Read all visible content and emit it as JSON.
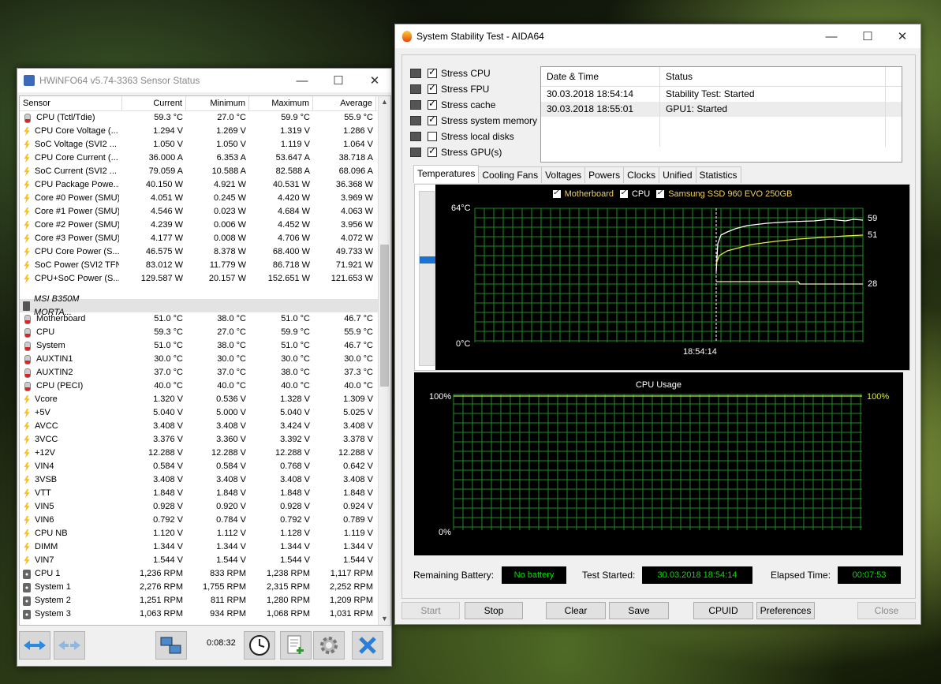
{
  "hwinfo": {
    "title": "HWiNFO64 v5.74-3363 Sensor Status",
    "columns": [
      "Sensor",
      "Current",
      "Minimum",
      "Maximum",
      "Average"
    ],
    "rows_top": [
      {
        "icon": "temp",
        "cells": [
          "CPU (Tctl/Tdie)",
          "59.3 °C",
          "27.0 °C",
          "59.9 °C",
          "55.9 °C"
        ]
      },
      {
        "icon": "volt",
        "cells": [
          "CPU Core Voltage (...",
          "1.294 V",
          "1.269 V",
          "1.319 V",
          "1.286 V"
        ]
      },
      {
        "icon": "volt",
        "cells": [
          "SoC Voltage (SVI2 ...",
          "1.050 V",
          "1.050 V",
          "1.119 V",
          "1.064 V"
        ]
      },
      {
        "icon": "volt",
        "cells": [
          "CPU Core Current (...",
          "36.000 A",
          "6.353 A",
          "53.647 A",
          "38.718 A"
        ]
      },
      {
        "icon": "volt",
        "cells": [
          "SoC Current (SVI2 ...",
          "79.059 A",
          "10.588 A",
          "82.588 A",
          "68.096 A"
        ]
      },
      {
        "icon": "volt",
        "cells": [
          "CPU Package Powe...",
          "40.150 W",
          "4.921 W",
          "40.531 W",
          "36.368 W"
        ]
      },
      {
        "icon": "volt",
        "cells": [
          "Core #0 Power (SMU)",
          "4.051 W",
          "0.245 W",
          "4.420 W",
          "3.969 W"
        ]
      },
      {
        "icon": "volt",
        "cells": [
          "Core #1 Power (SMU)",
          "4.546 W",
          "0.023 W",
          "4.684 W",
          "4.063 W"
        ]
      },
      {
        "icon": "volt",
        "cells": [
          "Core #2 Power (SMU)",
          "4.239 W",
          "0.006 W",
          "4.452 W",
          "3.956 W"
        ]
      },
      {
        "icon": "volt",
        "cells": [
          "Core #3 Power (SMU)",
          "4.177 W",
          "0.008 W",
          "4.706 W",
          "4.072 W"
        ]
      },
      {
        "icon": "volt",
        "cells": [
          "CPU Core Power (S...",
          "46.575 W",
          "8.378 W",
          "68.400 W",
          "49.733 W"
        ]
      },
      {
        "icon": "volt",
        "cells": [
          "SoC Power (SVI2 TFN)",
          "83.012 W",
          "11.779 W",
          "86.718 W",
          "71.921 W"
        ]
      },
      {
        "icon": "volt",
        "cells": [
          "CPU+SoC Power (S...",
          "129.587 W",
          "20.157 W",
          "152.651 W",
          "121.653 W"
        ]
      }
    ],
    "group_label": "MSI B350M MORTA...",
    "rows_bottom": [
      {
        "icon": "temp",
        "cells": [
          "Motherboard",
          "51.0 °C",
          "38.0 °C",
          "51.0 °C",
          "46.7 °C"
        ]
      },
      {
        "icon": "temp",
        "cells": [
          "CPU",
          "59.3 °C",
          "27.0 °C",
          "59.9 °C",
          "55.9 °C"
        ]
      },
      {
        "icon": "temp",
        "cells": [
          "System",
          "51.0 °C",
          "38.0 °C",
          "51.0 °C",
          "46.7 °C"
        ]
      },
      {
        "icon": "temp",
        "cells": [
          "AUXTIN1",
          "30.0 °C",
          "30.0 °C",
          "30.0 °C",
          "30.0 °C"
        ]
      },
      {
        "icon": "temp",
        "cells": [
          "AUXTIN2",
          "37.0 °C",
          "37.0 °C",
          "38.0 °C",
          "37.3 °C"
        ]
      },
      {
        "icon": "temp",
        "cells": [
          "CPU (PECI)",
          "40.0 °C",
          "40.0 °C",
          "40.0 °C",
          "40.0 °C"
        ]
      },
      {
        "icon": "volt",
        "cells": [
          "Vcore",
          "1.320 V",
          "0.536 V",
          "1.328 V",
          "1.309 V"
        ]
      },
      {
        "icon": "volt",
        "cells": [
          "+5V",
          "5.040 V",
          "5.000 V",
          "5.040 V",
          "5.025 V"
        ]
      },
      {
        "icon": "volt",
        "cells": [
          "AVCC",
          "3.408 V",
          "3.408 V",
          "3.424 V",
          "3.408 V"
        ]
      },
      {
        "icon": "volt",
        "cells": [
          "3VCC",
          "3.376 V",
          "3.360 V",
          "3.392 V",
          "3.378 V"
        ]
      },
      {
        "icon": "volt",
        "cells": [
          "+12V",
          "12.288 V",
          "12.288 V",
          "12.288 V",
          "12.288 V"
        ]
      },
      {
        "icon": "volt",
        "cells": [
          "VIN4",
          "0.584 V",
          "0.584 V",
          "0.768 V",
          "0.642 V"
        ]
      },
      {
        "icon": "volt",
        "cells": [
          "3VSB",
          "3.408 V",
          "3.408 V",
          "3.408 V",
          "3.408 V"
        ]
      },
      {
        "icon": "volt",
        "cells": [
          "VTT",
          "1.848 V",
          "1.848 V",
          "1.848 V",
          "1.848 V"
        ]
      },
      {
        "icon": "volt",
        "cells": [
          "VIN5",
          "0.928 V",
          "0.920 V",
          "0.928 V",
          "0.924 V"
        ]
      },
      {
        "icon": "volt",
        "cells": [
          "VIN6",
          "0.792 V",
          "0.784 V",
          "0.792 V",
          "0.789 V"
        ]
      },
      {
        "icon": "volt",
        "cells": [
          "CPU NB",
          "1.120 V",
          "1.112 V",
          "1.128 V",
          "1.119 V"
        ]
      },
      {
        "icon": "volt",
        "cells": [
          "DIMM",
          "1.344 V",
          "1.344 V",
          "1.344 V",
          "1.344 V"
        ]
      },
      {
        "icon": "volt",
        "cells": [
          "VIN7",
          "1.544 V",
          "1.544 V",
          "1.544 V",
          "1.544 V"
        ]
      },
      {
        "icon": "fan",
        "cells": [
          "CPU 1",
          "1,236 RPM",
          "833 RPM",
          "1,238 RPM",
          "1,117 RPM"
        ]
      },
      {
        "icon": "fan",
        "cells": [
          "System 1",
          "2,276 RPM",
          "1,755 RPM",
          "2,315 RPM",
          "2,252 RPM"
        ]
      },
      {
        "icon": "fan",
        "cells": [
          "System 2",
          "1,251 RPM",
          "811 RPM",
          "1,280 RPM",
          "1,209 RPM"
        ]
      },
      {
        "icon": "fan",
        "cells": [
          "System 3",
          "1,063 RPM",
          "934 RPM",
          "1,068 RPM",
          "1,031 RPM"
        ]
      }
    ],
    "timer": "0:08:32"
  },
  "aida": {
    "title": "System Stability Test - AIDA64",
    "stress_options": [
      {
        "label": "Stress CPU",
        "checked": true,
        "icon": "cpu-icon"
      },
      {
        "label": "Stress FPU",
        "checked": true,
        "icon": "fpu-icon"
      },
      {
        "label": "Stress cache",
        "checked": true,
        "icon": "cache-icon"
      },
      {
        "label": "Stress system memory",
        "checked": true,
        "icon": "memory-icon"
      },
      {
        "label": "Stress local disks",
        "checked": false,
        "icon": "disk-icon"
      },
      {
        "label": "Stress GPU(s)",
        "checked": true,
        "icon": "gpu-icon"
      }
    ],
    "log": {
      "headers": [
        "Date & Time",
        "Status"
      ],
      "rows": [
        [
          "30.03.2018 18:54:14",
          "Stability Test: Started"
        ],
        [
          "30.03.2018 18:55:01",
          "GPU1: Started"
        ]
      ]
    },
    "tabs": [
      "Temperatures",
      "Cooling Fans",
      "Voltages",
      "Powers",
      "Clocks",
      "Unified",
      "Statistics"
    ],
    "active_tab": "Temperatures",
    "temp_legend": [
      "Motherboard",
      "CPU",
      "Samsung SSD 960 EVO 250GB"
    ],
    "temp_axis_top": "64°C",
    "temp_axis_bottom": "0°C",
    "temp_time_label": "18:54:14",
    "temp_values": [
      "59",
      "51",
      "28"
    ],
    "cpu_usage_title": "CPU Usage",
    "cpu_axis_top": "100%",
    "cpu_axis_bottom": "0%",
    "cpu_value": "100%",
    "status": {
      "battery_label": "Remaining Battery:",
      "battery_value": "No battery",
      "started_label": "Test Started:",
      "started_value": "30.03.2018 18:54:14",
      "elapsed_label": "Elapsed Time:",
      "elapsed_value": "00:07:53"
    },
    "buttons": {
      "start": "Start",
      "stop": "Stop",
      "clear": "Clear",
      "save": "Save",
      "cpuid": "CPUID",
      "preferences": "Preferences",
      "close": "Close"
    }
  },
  "colors": {
    "grid_green": "#1f8c1f",
    "chart_bg": "#000000",
    "cpu_line": "#ffffff",
    "mb_line": "#e8e84a",
    "ssd_line": "#f3ebb8",
    "usage_line": "#c9e64a",
    "legend_text_cpu": "#ffffff",
    "legend_text_mb": "#f0d060"
  }
}
